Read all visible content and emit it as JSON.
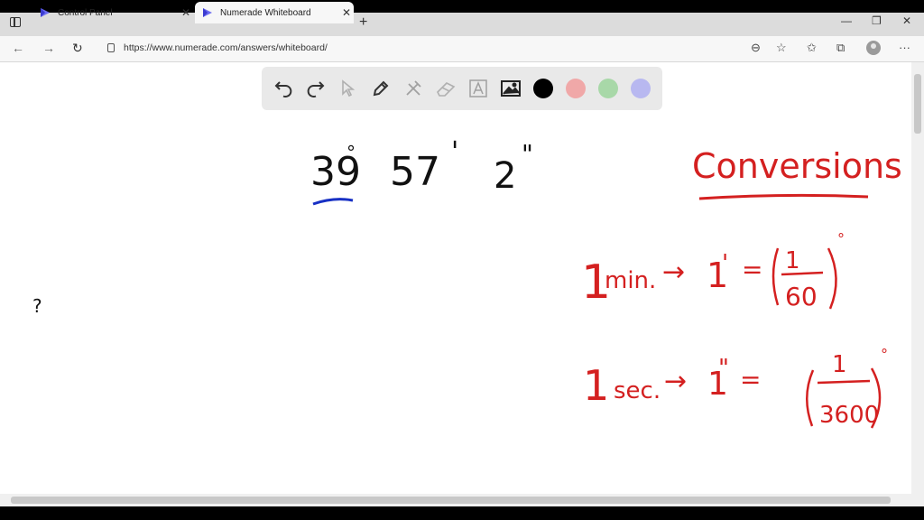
{
  "browser": {
    "tabs": [
      {
        "label": "Control Panel",
        "icon": "numerade-logo-icon",
        "close": "✕"
      },
      {
        "label": "Numerade Whiteboard",
        "icon": "numerade-logo-icon",
        "close": "✕",
        "active": true
      }
    ],
    "new_tab": "+",
    "window_controls": {
      "minimize": "—",
      "restore": "❐",
      "close": "✕"
    },
    "nav": {
      "back": "←",
      "forward": "→",
      "reload": "↻"
    },
    "url": "https://www.numerade.com/answers/whiteboard/",
    "right_tools": {
      "zoom": "⊖",
      "favorite_add": "☆",
      "favorites": "✩",
      "collections": "⧉",
      "menu": "···"
    }
  },
  "toolbar": {
    "tools": [
      "undo-icon",
      "redo-icon",
      "pointer-icon",
      "pen-icon",
      "tools-icon",
      "eraser-icon",
      "text-icon",
      "image-icon"
    ],
    "colors": [
      "#000000",
      "#f0a8a8",
      "#a8d8a8",
      "#b8b8f0"
    ]
  },
  "whiteboard": {
    "angle": {
      "degrees": "39",
      "deg_mark": "°",
      "minutes": "57",
      "min_mark": "'",
      "seconds": "2",
      "sec_mark": "\""
    },
    "title": "Conversions",
    "row1": {
      "lhs": "1",
      "unit": "min.",
      "arrow": "→",
      "mid": "1",
      "mark": "'",
      "eq": "=",
      "num": "1",
      "den": "60",
      "sup": "°"
    },
    "row2": {
      "lhs": "1",
      "unit": "sec.",
      "arrow": "→",
      "mid": "1",
      "mark": "\"",
      "eq": "=",
      "num": "1",
      "den": "3600",
      "sup": "°"
    },
    "stray": "?",
    "ink_colors": {
      "black": "#111111",
      "red": "#d42020",
      "blue": "#1730c4"
    }
  }
}
